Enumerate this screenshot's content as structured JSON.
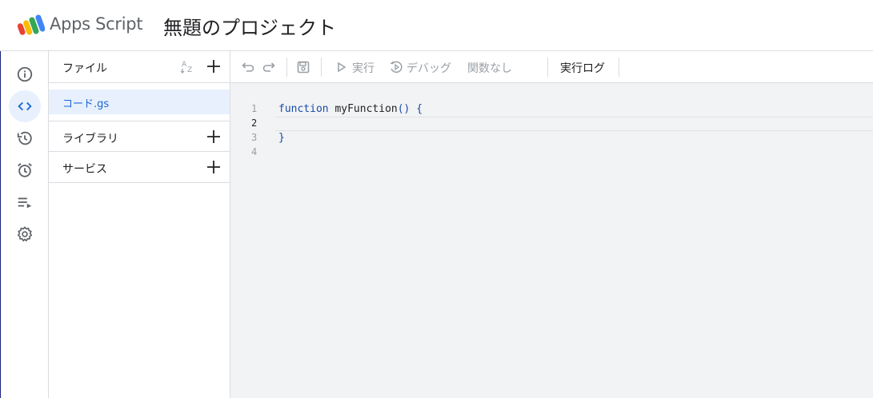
{
  "header": {
    "app_name": "Apps Script",
    "project_title": "無題のプロジェクト"
  },
  "rail": {
    "items": [
      {
        "icon": "info-icon",
        "active": false
      },
      {
        "icon": "code-icon",
        "active": true
      },
      {
        "icon": "history-icon",
        "active": false
      },
      {
        "icon": "alarm-icon",
        "active": false
      },
      {
        "icon": "executions-icon",
        "active": false
      },
      {
        "icon": "gear-icon",
        "active": false
      }
    ]
  },
  "panel": {
    "files_label": "ファイル",
    "file_name": "コード.gs",
    "libraries_label": "ライブラリ",
    "services_label": "サービス"
  },
  "toolbar": {
    "run_label": "実行",
    "debug_label": "デバッグ",
    "function_select": "関数なし",
    "log_label": "実行ログ"
  },
  "editor": {
    "line_numbers": [
      "1",
      "2",
      "3",
      "4"
    ],
    "code": {
      "keyword": "function",
      "name": "myFunction",
      "open": "() {",
      "close": "}"
    }
  },
  "colors": {
    "accent": "#1967d2",
    "active_bg": "#e8f0fe",
    "editor_bg": "#f1f3f4"
  }
}
